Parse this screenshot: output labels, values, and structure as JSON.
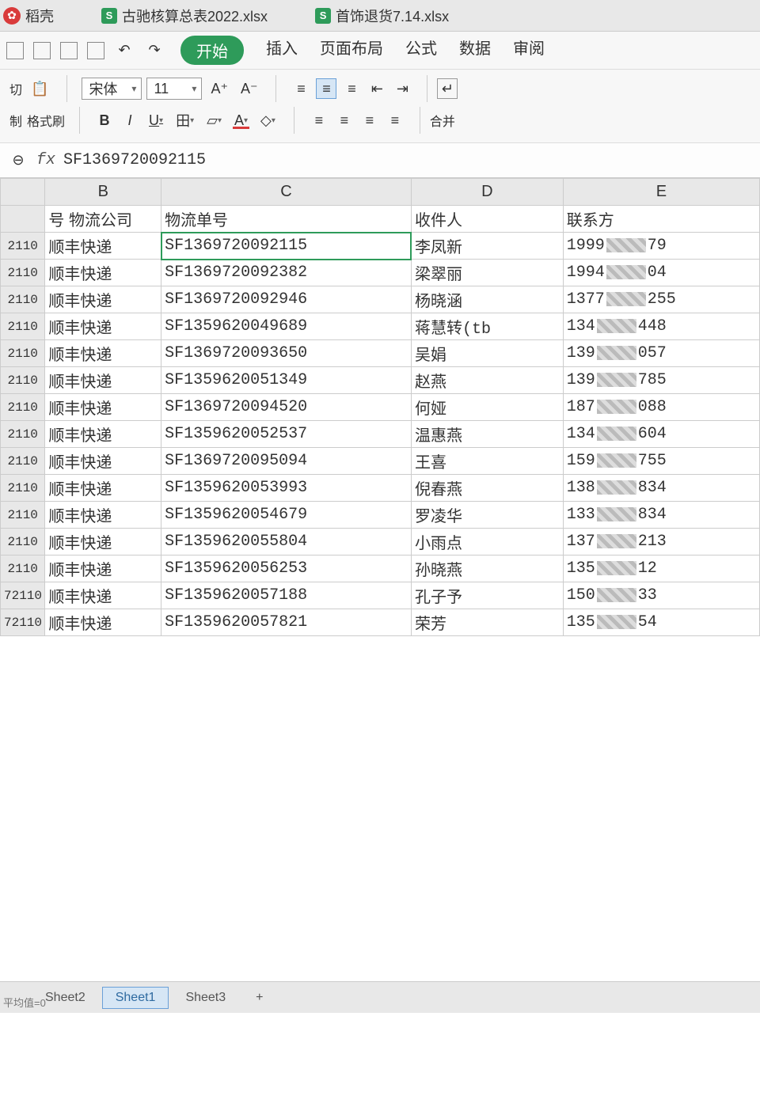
{
  "tabs": {
    "docer": "稻壳",
    "file1": "古驰核算总表2022.xlsx",
    "file2": "首饰退货7.14.xlsx"
  },
  "menu": {
    "start": "开始",
    "insert": "插入",
    "layout": "页面布局",
    "formula": "公式",
    "data": "数据",
    "review": "审阅"
  },
  "toolbar": {
    "cut": "切",
    "copy": "制",
    "fmtpt": "格式刷",
    "font_name": "宋体",
    "font_size": "11",
    "inc_font": "A⁺",
    "dec_font": "A⁻",
    "bold": "B",
    "italic": "I",
    "underline": "U",
    "border": "田",
    "fill": "▱",
    "font_color": "A",
    "eraser": "◇",
    "merge": "合并"
  },
  "formula_bar": {
    "zoom": "⊖",
    "fx": "fx",
    "value": "SF1369720092115"
  },
  "columns": {
    "B": "B",
    "C": "C",
    "D": "D",
    "E": "E"
  },
  "headers": {
    "A": "号",
    "B": "物流公司",
    "C": "物流单号",
    "D": "收件人",
    "E": "联系方"
  },
  "rows": [
    {
      "a": "2110",
      "b": "顺丰快递",
      "c": "SF1369720092115",
      "d": "李凤新",
      "e1": "1999",
      "e2": "79"
    },
    {
      "a": "2110",
      "b": "顺丰快递",
      "c": "SF1369720092382",
      "d": "梁翠丽",
      "e1": "1994",
      "e2": "04"
    },
    {
      "a": "2110",
      "b": "顺丰快递",
      "c": "SF1369720092946",
      "d": "杨晓涵",
      "e1": "1377",
      "e2": "255"
    },
    {
      "a": "2110",
      "b": "顺丰快递",
      "c": "SF1359620049689",
      "d": "蒋慧转(tb",
      "e1": "134",
      "e2": "448"
    },
    {
      "a": "2110",
      "b": "顺丰快递",
      "c": "SF1369720093650",
      "d": "吴娟",
      "e1": "139",
      "e2": "057"
    },
    {
      "a": "2110",
      "b": "顺丰快递",
      "c": "SF1359620051349",
      "d": "赵燕",
      "e1": "139",
      "e2": "785"
    },
    {
      "a": "2110",
      "b": "顺丰快递",
      "c": "SF1369720094520",
      "d": "何娅",
      "e1": "187",
      "e2": "088"
    },
    {
      "a": "2110",
      "b": "顺丰快递",
      "c": "SF1359620052537",
      "d": "温惠燕",
      "e1": "134",
      "e2": "604"
    },
    {
      "a": "2110",
      "b": "顺丰快递",
      "c": "SF1369720095094",
      "d": "王喜",
      "e1": "159",
      "e2": "755"
    },
    {
      "a": "2110",
      "b": "顺丰快递",
      "c": "SF1359620053993",
      "d": "倪春燕",
      "e1": "138",
      "e2": "834"
    },
    {
      "a": "2110",
      "b": "顺丰快递",
      "c": "SF1359620054679",
      "d": "罗凌华",
      "e1": "133",
      "e2": "834"
    },
    {
      "a": "2110",
      "b": "顺丰快递",
      "c": "SF1359620055804",
      "d": "小雨点",
      "e1": "137",
      "e2": "213"
    },
    {
      "a": "2110",
      "b": "顺丰快递",
      "c": "SF1359620056253",
      "d": "孙晓燕",
      "e1": "135",
      "e2": "12"
    },
    {
      "a": "72110",
      "b": "顺丰快递",
      "c": "SF1359620057188",
      "d": "孔子予",
      "e1": "150",
      "e2": "33"
    },
    {
      "a": "72110",
      "b": "顺丰快递",
      "c": "SF1359620057821",
      "d": "荣芳",
      "e1": "135",
      "e2": "54"
    }
  ],
  "sheets": {
    "s1": "Sheet2",
    "s2": "Sheet1",
    "s3": "Sheet3",
    "add": "+"
  },
  "status": "平均值=0"
}
